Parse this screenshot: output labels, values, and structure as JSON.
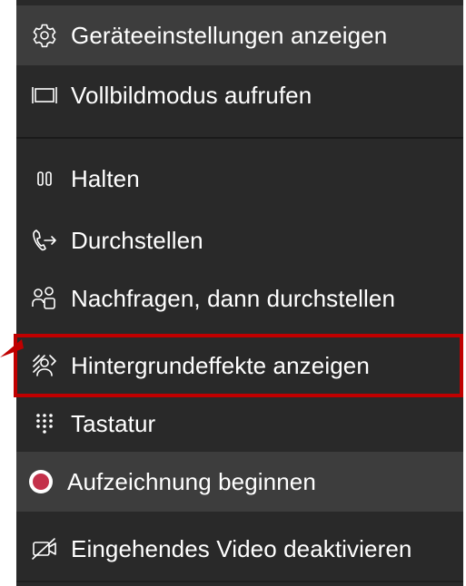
{
  "menu": {
    "items": [
      {
        "label": "Geräteeinstellungen anzeigen",
        "icon": "gear-icon"
      },
      {
        "label": "Vollbildmodus aufrufen",
        "icon": "fullscreen-icon"
      },
      {
        "label": "Halten",
        "icon": "pause-icon"
      },
      {
        "label": "Durchstellen",
        "icon": "transfer-call-icon"
      },
      {
        "label": "Nachfragen, dann durchstellen",
        "icon": "consult-transfer-icon"
      },
      {
        "label": "Hintergrundeffekte anzeigen",
        "icon": "background-effects-icon"
      },
      {
        "label": "Tastatur",
        "icon": "dialpad-icon"
      },
      {
        "label": "Aufzeichnung beginnen",
        "icon": "record-icon"
      },
      {
        "label": "Eingehendes Video deaktivieren",
        "icon": "video-off-icon"
      }
    ]
  },
  "colors": {
    "menu_background": "#292929",
    "hover_background": "#3d3d3d",
    "highlight_border": "#c00000",
    "record_red": "#c4314b"
  }
}
